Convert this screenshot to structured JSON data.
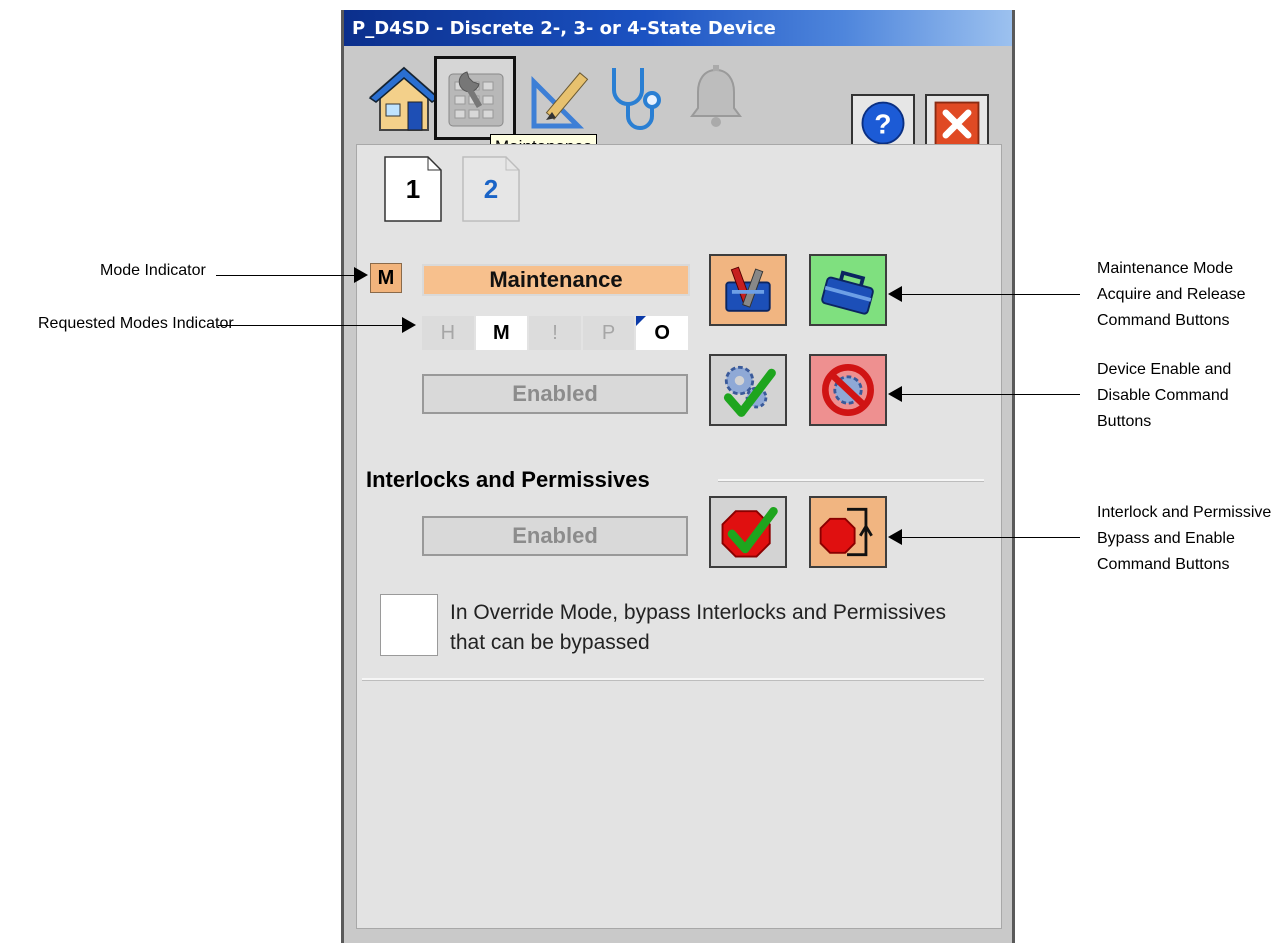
{
  "window": {
    "title": "P_D4SD - Discrete 2-, 3- or 4-State Device"
  },
  "toolbar": {
    "tabs": [
      {
        "name": "home-icon"
      },
      {
        "name": "maintenance-icon"
      },
      {
        "name": "engineering-icon"
      },
      {
        "name": "diagnostics-icon"
      },
      {
        "name": "alarms-icon"
      }
    ],
    "tooltip": "Maintenance",
    "help_icon": "question-icon",
    "close_icon": "close-icon"
  },
  "pages": [
    "1",
    "2"
  ],
  "mode": {
    "indicator": "M",
    "current": "Maintenance",
    "requested": [
      "H",
      "M",
      "!",
      "P",
      "O"
    ]
  },
  "device_status": "Enabled",
  "interlocks": {
    "heading": "Interlocks and Permissives",
    "status": "Enabled",
    "override_label": "In Override Mode, bypass Interlocks and Permissives that can be bypassed"
  },
  "callouts": {
    "mode_indicator": "Mode Indicator",
    "requested_modes": "Requested Modes Indicator",
    "maint_mode_line1": "Maintenance Mode",
    "maint_mode_line2": "Acquire and Release",
    "maint_mode_line3": "Command Buttons",
    "device_line1": "Device Enable and",
    "device_line2": "Disable Command",
    "device_line3": "Buttons",
    "interlock_line1": "Interlock and Permissive",
    "interlock_line2": "Bypass and Enable",
    "interlock_line3": "Command Buttons"
  },
  "colors": {
    "maintenance": "#f7c08d",
    "titlebar": "#1b52c2",
    "panel": "#e3e3e3"
  }
}
